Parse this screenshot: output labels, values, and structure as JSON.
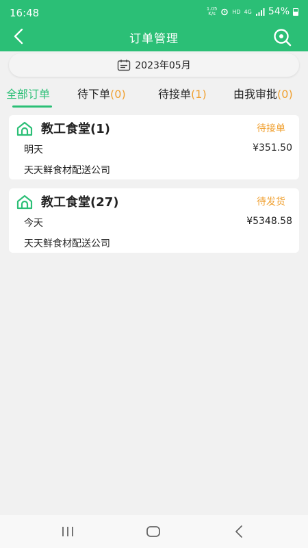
{
  "status_bar": {
    "time": "16:48",
    "net_speed_top": "1.05",
    "net_speed_bottom": "K/s",
    "hd_label": "HD",
    "network_type": "4G",
    "battery_percent": "54%"
  },
  "nav": {
    "title": "订单管理",
    "back_icon": "chevron-left-icon",
    "search_icon": "search-eye-icon"
  },
  "date_filter": {
    "label": "2023年05月",
    "icon": "calendar-icon"
  },
  "tabs": [
    {
      "label": "全部订单",
      "count": "",
      "active": true
    },
    {
      "label": "待下单",
      "count": "(0)",
      "active": false
    },
    {
      "label": "待接单",
      "count": "(1)",
      "active": false
    },
    {
      "label": "由我审批",
      "count": "(0)",
      "active": false
    }
  ],
  "orders": [
    {
      "canteen": "教工食堂(1)",
      "status": "待接单",
      "day": "明天",
      "amount": "¥351.50",
      "supplier": "天天鲜食材配送公司"
    },
    {
      "canteen": "教工食堂(27)",
      "status": "待发货",
      "day": "今天",
      "amount": "¥5348.58",
      "supplier": "天天鲜食材配送公司"
    }
  ],
  "colors": {
    "primary": "#2bbf76",
    "accent_orange": "#f0a030",
    "background": "#f1f1f1"
  },
  "bottom_nav": {
    "items": [
      "recent-apps-icon",
      "home-icon",
      "back-icon"
    ]
  }
}
